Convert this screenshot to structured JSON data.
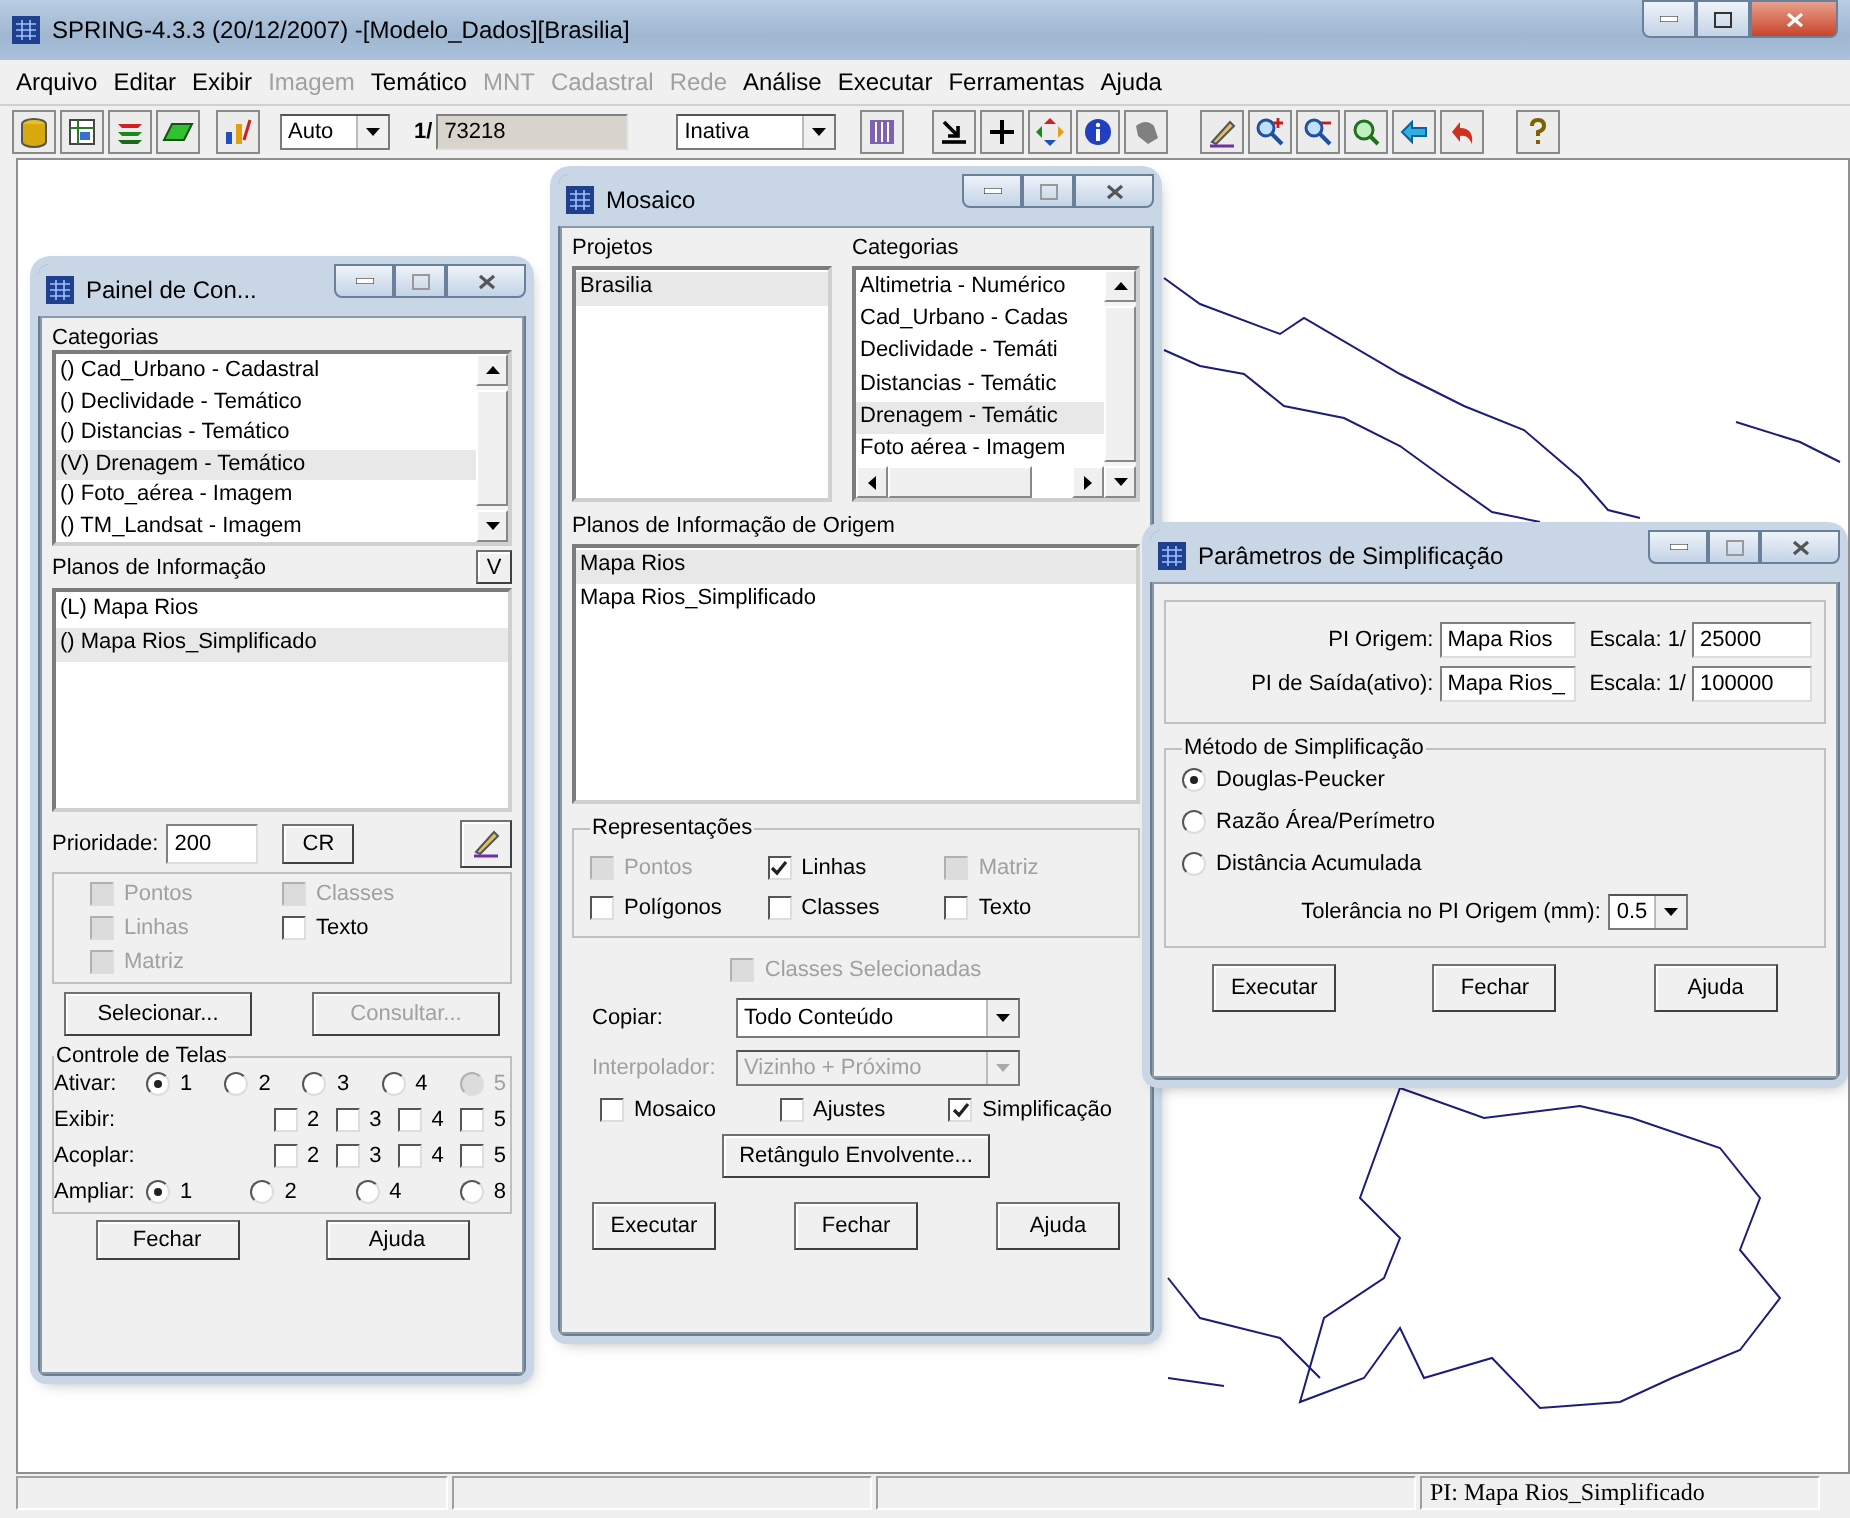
{
  "window": {
    "title": "SPRING-4.3.3 (20/12/2007) -[Modelo_Dados][Brasilia]"
  },
  "menu": [
    {
      "label": "Arquivo",
      "disabled": false
    },
    {
      "label": "Editar",
      "disabled": false
    },
    {
      "label": "Exibir",
      "disabled": false
    },
    {
      "label": "Imagem",
      "disabled": true
    },
    {
      "label": "Temático",
      "disabled": false
    },
    {
      "label": "MNT",
      "disabled": true
    },
    {
      "label": "Cadastral",
      "disabled": true
    },
    {
      "label": "Rede",
      "disabled": true
    },
    {
      "label": "Análise",
      "disabled": false
    },
    {
      "label": "Executar",
      "disabled": false
    },
    {
      "label": "Ferramentas",
      "disabled": false
    },
    {
      "label": "Ajuda",
      "disabled": false
    }
  ],
  "toolbar": {
    "zoom_mode": "Auto",
    "scale_prefix": "1/",
    "scale": "73218",
    "cursor_mode": "Inativa"
  },
  "control_panel": {
    "title": "Painel de Con...",
    "categories_label": "Categorias",
    "categories": [
      {
        "label": "() Cad_Urbano - Cadastral",
        "selected": false
      },
      {
        "label": "() Declividade - Temático",
        "selected": false
      },
      {
        "label": "() Distancias - Temático",
        "selected": false
      },
      {
        "label": "(V) Drenagem - Temático",
        "selected": true
      },
      {
        "label": "() Foto_aérea - Imagem",
        "selected": false
      },
      {
        "label": "() TM_Landsat - Imagem",
        "selected": false
      }
    ],
    "planes_label": "Planos de Informação",
    "planes_button": "V",
    "planes": [
      {
        "label": "(L) Mapa Rios",
        "selected": false
      },
      {
        "label": "() Mapa Rios_Simplificado",
        "selected": true
      }
    ],
    "priority_label": "Prioridade:",
    "priority": "200",
    "cr_button": "CR",
    "representations": [
      {
        "label": "Pontos",
        "checked": false,
        "disabled": true
      },
      {
        "label": "Classes",
        "checked": false,
        "disabled": true
      },
      {
        "label": "Linhas",
        "checked": false,
        "disabled": true
      },
      {
        "label": "Texto",
        "checked": false,
        "disabled": false
      },
      {
        "label": "Matriz",
        "checked": false,
        "disabled": true
      }
    ],
    "select_button": {
      "label": "Selecionar...",
      "disabled": false
    },
    "query_button": {
      "label": "Consultar...",
      "disabled": true
    },
    "screens_title": "Controle de Telas",
    "screens": [
      {
        "label": "Ativar:",
        "kind": "radio",
        "options": [
          {
            "label": "1",
            "checked": true,
            "disabled": false
          },
          {
            "label": "2",
            "checked": false,
            "disabled": false
          },
          {
            "label": "3",
            "checked": false,
            "disabled": false
          },
          {
            "label": "4",
            "checked": false,
            "disabled": false
          },
          {
            "label": "5",
            "checked": false,
            "disabled": true
          }
        ]
      },
      {
        "label": "Exibir:",
        "kind": "check",
        "options": [
          {
            "label": "2",
            "checked": false,
            "disabled": false
          },
          {
            "label": "3",
            "checked": false,
            "disabled": false
          },
          {
            "label": "4",
            "checked": false,
            "disabled": false
          },
          {
            "label": "5",
            "checked": false,
            "disabled": false
          }
        ]
      },
      {
        "label": "Acoplar:",
        "kind": "check",
        "options": [
          {
            "label": "2",
            "checked": false,
            "disabled": false
          },
          {
            "label": "3",
            "checked": false,
            "disabled": false
          },
          {
            "label": "4",
            "checked": false,
            "disabled": false
          },
          {
            "label": "5",
            "checked": false,
            "disabled": false
          }
        ]
      },
      {
        "label": "Ampliar:",
        "kind": "radio",
        "options": [
          {
            "label": "1",
            "checked": true,
            "disabled": false
          },
          {
            "label": "2",
            "checked": false,
            "disabled": false
          },
          {
            "label": "4",
            "checked": false,
            "disabled": false
          },
          {
            "label": "8",
            "checked": false,
            "disabled": false
          }
        ]
      }
    ],
    "buttons": [
      "Fechar",
      "Ajuda"
    ]
  },
  "mosaic": {
    "title": "Mosaico",
    "projects_label": "Projetos",
    "projects": [
      {
        "label": "Brasilia",
        "selected": true
      }
    ],
    "categories_label": "Categorias",
    "categories": [
      {
        "label": "Altimetria - Numérico",
        "selected": false
      },
      {
        "label": "Cad_Urbano - Cadas",
        "selected": false
      },
      {
        "label": "Declividade - Temáti",
        "selected": false
      },
      {
        "label": "Distancias - Temátic",
        "selected": false
      },
      {
        "label": "Drenagem - Temátic",
        "selected": true
      },
      {
        "label": "Foto aérea - Imagem",
        "selected": false
      }
    ],
    "planes_label": "Planos de Informação de Origem",
    "planes": [
      {
        "label": "Mapa Rios",
        "selected": true
      },
      {
        "label": "Mapa Rios_Simplificado",
        "selected": false
      }
    ],
    "representations_title": "Representações",
    "representations": [
      {
        "label": "Pontos",
        "checked": false,
        "disabled": true
      },
      {
        "label": "Linhas",
        "checked": true,
        "disabled": false
      },
      {
        "label": "Matriz",
        "checked": false,
        "disabled": true
      },
      {
        "label": "Polígonos",
        "checked": false,
        "disabled": false
      },
      {
        "label": "Classes",
        "checked": false,
        "disabled": false
      },
      {
        "label": "Texto",
        "checked": false,
        "disabled": false
      }
    ],
    "selected_classes": {
      "label": "Classes Selecionadas",
      "checked": false,
      "disabled": true
    },
    "copy_label": "Copiar:",
    "copy_value": "Todo Conteúdo",
    "interpolator_label": "Interpolador:",
    "interpolator_value": "Vizinho + Próximo",
    "options": [
      {
        "label": "Mosaico",
        "checked": false,
        "disabled": false
      },
      {
        "label": "Ajustes",
        "checked": false,
        "disabled": false
      },
      {
        "label": "Simplificação",
        "checked": true,
        "disabled": false
      }
    ],
    "bbox_button": "Retângulo Envolvente...",
    "buttons": [
      "Executar",
      "Fechar",
      "Ajuda"
    ]
  },
  "simplification": {
    "title": "Parâmetros de Simplificação",
    "layers": [
      {
        "label": "PI Origem:",
        "value": "Mapa Rios",
        "scale_label": "Escala: 1/",
        "scale": "25000"
      },
      {
        "label": "PI de Saída(ativo):",
        "value": "Mapa Rios_",
        "scale_label": "Escala: 1/",
        "scale": "100000"
      }
    ],
    "method_title": "Método de Simplificação",
    "methods": [
      {
        "label": "Douglas-Peucker",
        "selected": true
      },
      {
        "label": "Razão Área/Perímetro",
        "selected": false
      },
      {
        "label": "Distância Acumulada",
        "selected": false
      }
    ],
    "tolerance_label": "Tolerância no PI Origem (mm):",
    "tolerance": "0.5",
    "buttons": [
      "Executar",
      "Fechar",
      "Ajuda"
    ]
  },
  "status_bar": {
    "plane": "PI: Mapa Rios_Simplificado"
  }
}
